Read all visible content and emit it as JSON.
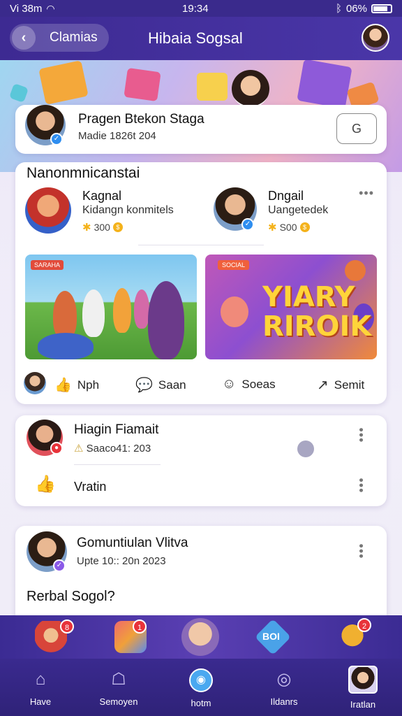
{
  "status_bar": {
    "left": "Vi  38m",
    "time": "19:34",
    "right": "06%"
  },
  "top_bar": {
    "back_label": "Clamias",
    "title": "Hibaia Sogsal"
  },
  "post_1": {
    "name": "Pragen Btekon Staga",
    "meta": "Madie 1826t 204",
    "button_icon": "G"
  },
  "post_2": {
    "title": "Nanonmnicanstai",
    "user_a": {
      "name": "Kagnal",
      "handle": "Kidangn konmitels",
      "coins": "300"
    },
    "user_b": {
      "name": "Dngail",
      "handle": "Uangetedek",
      "coins": "S00"
    },
    "image_1_tag": "SARAHA",
    "image_2_tag": "SOCIAL",
    "image_2_title_line1": "YIARY",
    "image_2_title_line2": "RIROIK",
    "actions": [
      {
        "icon": "like-icon",
        "glyph": "👍",
        "label": "Nph"
      },
      {
        "icon": "comment-icon",
        "glyph": "💬",
        "label": "Saan"
      },
      {
        "icon": "chat-icon",
        "glyph": "☺",
        "label": "Soeas"
      },
      {
        "icon": "share-icon",
        "glyph": "↗",
        "label": "Semit"
      }
    ]
  },
  "post_3": {
    "name": "Hiagin Fiamait",
    "meta": "Saaco41: 203",
    "action_label": "Vratin"
  },
  "post_4": {
    "name": "Gomuntiulan Vlitva",
    "meta": "Upte 10:: 20n 2023",
    "heading": "Rerbal Sogol?"
  },
  "strip_badges": [
    "8",
    "1",
    "",
    "",
    "2"
  ],
  "strip_center_label": "BOI",
  "bottom_nav": [
    {
      "icon": "home-icon",
      "label": "Have"
    },
    {
      "icon": "groups-icon",
      "label": "Semoyen"
    },
    {
      "icon": "feed-icon",
      "label": "hotm"
    },
    {
      "icon": "notifications-icon",
      "label": "Ildanrs"
    },
    {
      "icon": "profile-icon",
      "label": "Iratlan"
    }
  ],
  "colors": {
    "brand": "#3d2a92",
    "accent": "#2f8ef0",
    "alert": "#e8333a"
  }
}
